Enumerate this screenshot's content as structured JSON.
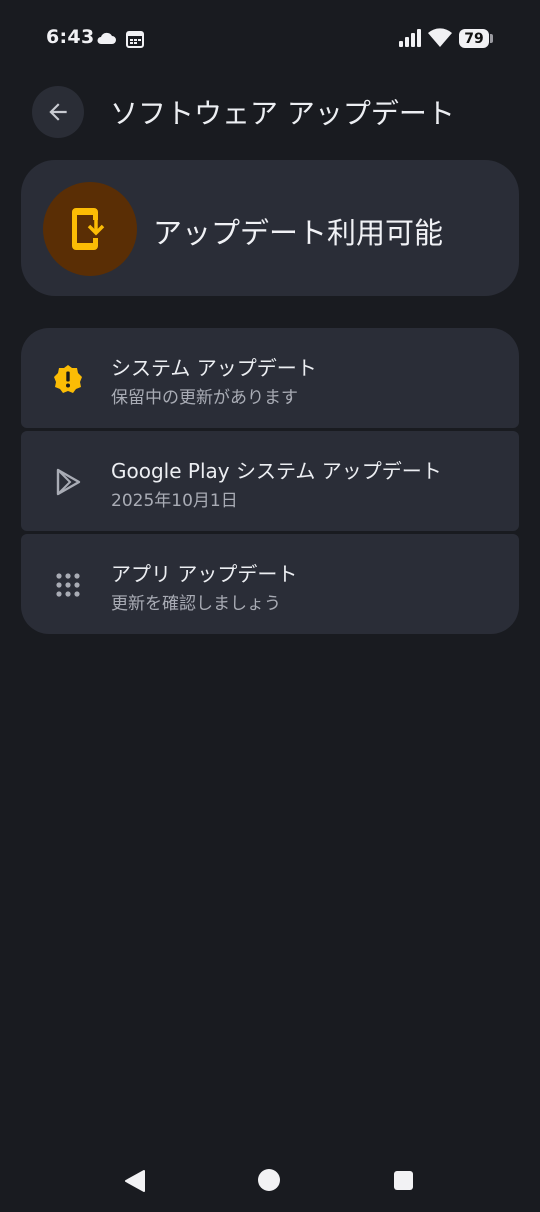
{
  "status_bar": {
    "time": "6:43",
    "battery": "79",
    "icons": [
      "cloud-icon",
      "calendar-icon",
      "signal-icon",
      "wifi-icon",
      "battery-icon"
    ]
  },
  "header": {
    "title": "ソフトウェア アップデート",
    "back_icon": "arrow-back-icon"
  },
  "hero": {
    "status": "アップデート利用可能",
    "icon": "phone-download-icon",
    "accent_color": "#fbbc05",
    "circle_color": "#5a2e05"
  },
  "items": [
    {
      "title": "システム アップデート",
      "subtitle": "保留中の更新があります",
      "icon": "alert-badge-icon"
    },
    {
      "title": "Google Play システム アップデート",
      "subtitle": "2025年10月1日",
      "icon": "play-icon"
    },
    {
      "title": "アプリ アップデート",
      "subtitle": "更新を確認しましょう",
      "icon": "apps-grid-icon"
    }
  ],
  "nav": {
    "icons": [
      "nav-back-icon",
      "nav-home-icon",
      "nav-recents-icon"
    ]
  }
}
